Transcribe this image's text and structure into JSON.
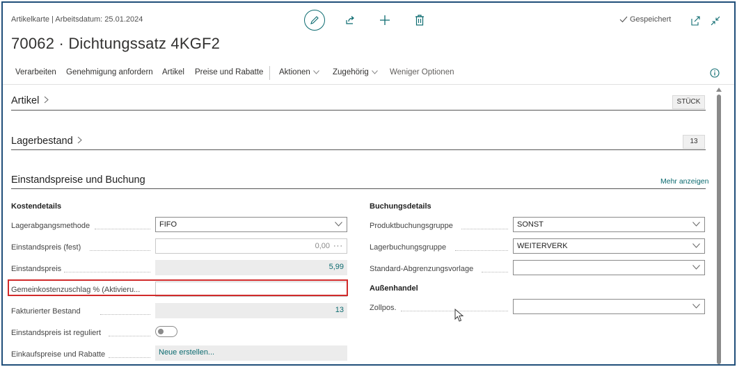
{
  "header": {
    "breadcrumb": "Artikelkarte | Arbeitsdatum: 25.01.2024",
    "title": "70062 · Dichtungssatz 4KGF2",
    "status": "Gespeichert"
  },
  "toolbar": {
    "icons": [
      "edit-icon",
      "share-icon",
      "add-icon",
      "delete-icon"
    ]
  },
  "nav": {
    "items": [
      "Verarbeiten",
      "Genehmigung anfordern",
      "Artikel",
      "Preise und Rabatte"
    ],
    "actions": "Aktionen",
    "related": "Zugehörig",
    "fewer": "Weniger Optionen"
  },
  "sections": {
    "artikel": {
      "title": "Artikel",
      "badge": "STÜCK"
    },
    "lager": {
      "title": "Lagerbestand",
      "badge": "13"
    },
    "costing": {
      "title": "Einstandspreise und Buchung",
      "more": "Mehr anzeigen"
    }
  },
  "cost": {
    "heading": "Kostendetails",
    "fields": [
      {
        "label": "Lagerabgangsmethode",
        "value": "FIFO"
      },
      {
        "label": "Einstandspreis (fest)",
        "value": "0,00"
      },
      {
        "label": "Einstandspreis",
        "value": "5,99"
      },
      {
        "label": "Gemeinkostenzuschlag % (Aktivieru...",
        "value": ""
      },
      {
        "label": "Fakturierter Bestand",
        "value": "13"
      },
      {
        "label": "Einstandspreis ist reguliert",
        "value": ""
      },
      {
        "label": "Einkaufspreise und Rabatte",
        "value": "Neue erstellen..."
      }
    ]
  },
  "posting": {
    "heading": "Buchungsdetails",
    "fields": [
      {
        "label": "Produktbuchungsgruppe",
        "value": "SONST"
      },
      {
        "label": "Lagerbuchungsgruppe",
        "value": "WEITERVERK"
      },
      {
        "label": "Standard-Abgrenzungsvorlage",
        "value": ""
      }
    ],
    "foreign_heading": "Außenhandel",
    "tariff_label": "Zollpos.",
    "tariff_value": ""
  },
  "colors": {
    "accent": "#0b6a6f",
    "highlight": "#d12a2a",
    "frame": "#1f4e79"
  }
}
